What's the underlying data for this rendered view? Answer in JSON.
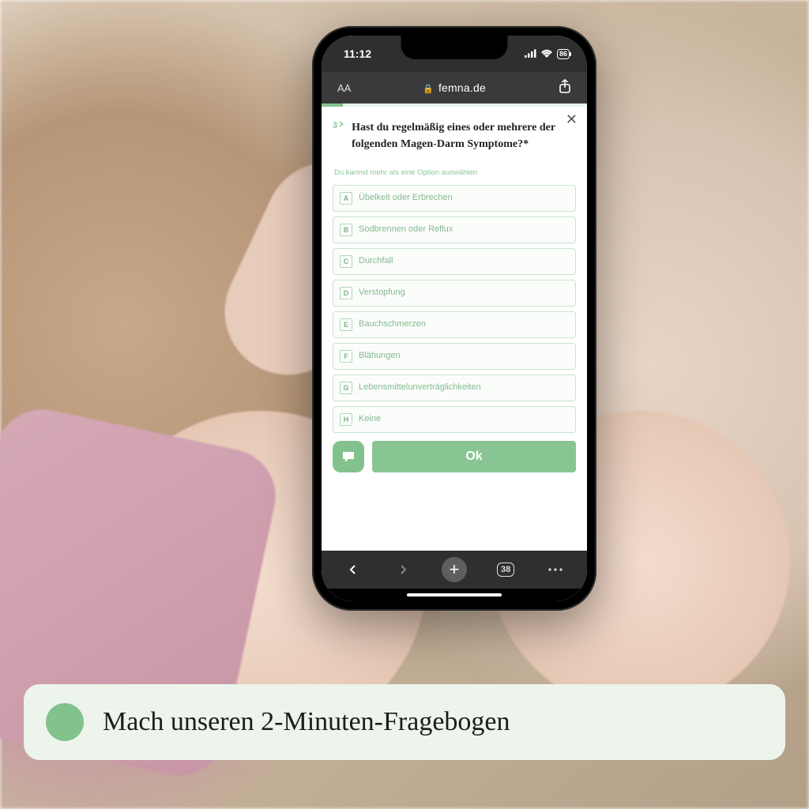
{
  "status": {
    "time": "11:12",
    "battery": "86"
  },
  "browser": {
    "domain": "femna.de",
    "tab_count": "38"
  },
  "survey": {
    "question_number": "3",
    "question": "Hast du regelmäßig eines oder mehrere der folgenden Magen-Darm Symptome?*",
    "hint": "Du kannst mehr als eine Option auswählen",
    "options": [
      {
        "key": "A",
        "label": "Übelkeit oder Erbrechen"
      },
      {
        "key": "B",
        "label": "Sodbrennen oder Reflux"
      },
      {
        "key": "C",
        "label": "Durchfall"
      },
      {
        "key": "D",
        "label": "Verstopfung"
      },
      {
        "key": "E",
        "label": "Bauchschmerzen"
      },
      {
        "key": "F",
        "label": "Blähungen"
      },
      {
        "key": "G",
        "label": "Lebensmittelunverträglichkeiten"
      },
      {
        "key": "H",
        "label": "Keine"
      }
    ],
    "ok_label": "Ok"
  },
  "banner": {
    "text": "Mach unseren 2-Minuten-Fragebogen"
  }
}
